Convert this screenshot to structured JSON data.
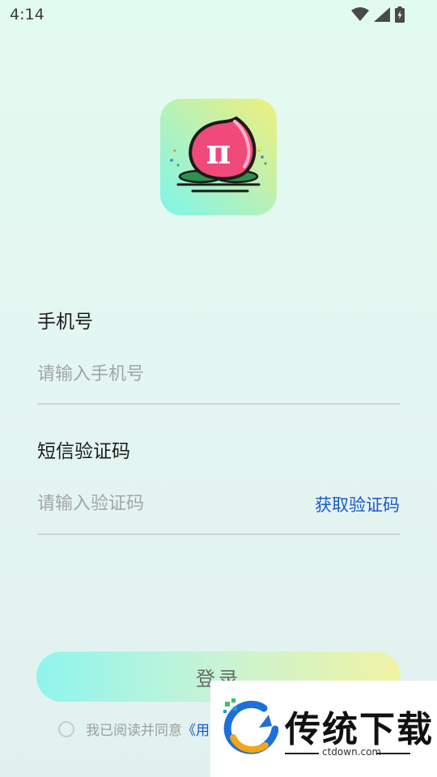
{
  "status_bar": {
    "time": "4:14",
    "icons": [
      "wifi-icon",
      "signal-icon",
      "battery-icon"
    ]
  },
  "app": {
    "icon_name": "pi-peach-logo",
    "icon_glyph": "π"
  },
  "form": {
    "phone": {
      "label": "手机号",
      "value": "",
      "placeholder": "请输入手机号"
    },
    "code": {
      "label": "短信验证码",
      "value": "",
      "placeholder": "请输入验证码",
      "get_code_label": "获取验证码"
    },
    "login_label": "登录",
    "agreement_text": "我已阅读并同意",
    "agreement_link": "《用"
  },
  "watermark": {
    "title": "传统下载",
    "url": "ctdown.com"
  },
  "colors": {
    "accent_link": "#1b58c9",
    "login_gradient_start": "#8ff5ee",
    "login_gradient_end": "#f0f3a4",
    "placeholder": "#a1a6a6"
  }
}
